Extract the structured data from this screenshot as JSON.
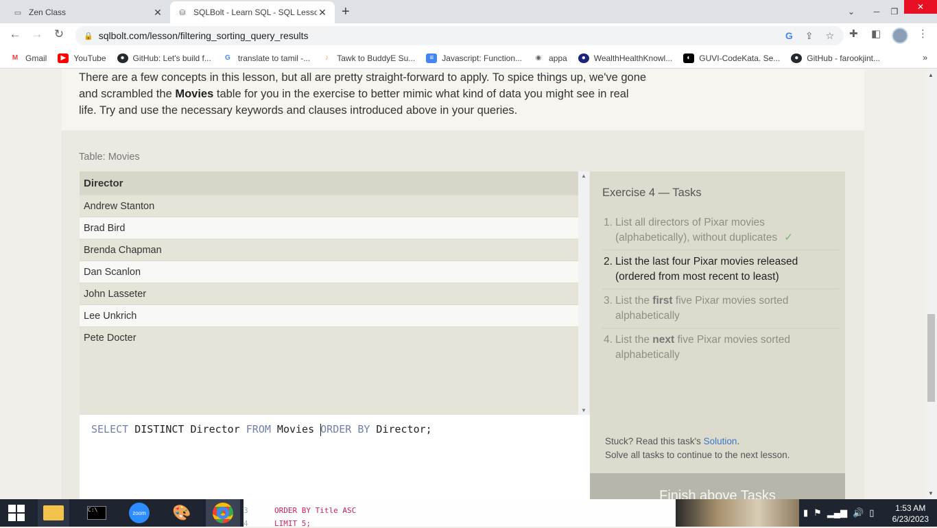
{
  "browser": {
    "tabs": [
      {
        "title": "Zen Class",
        "active": false
      },
      {
        "title": "SQLBolt - Learn SQL - SQL Lesso",
        "active": true
      }
    ],
    "url": "sqlbolt.com/lesson/filtering_sorting_query_results",
    "bookmarks": [
      {
        "label": "Gmail",
        "icon": "gmail-icon",
        "color": "#ea4335"
      },
      {
        "label": "YouTube",
        "icon": "youtube-icon",
        "color": "#ff0000"
      },
      {
        "label": "GitHub: Let's build f...",
        "icon": "github-icon",
        "color": "#24292e"
      },
      {
        "label": "translate to tamil -...",
        "icon": "google-icon",
        "color": "#4285f4"
      },
      {
        "label": "Tawk to BuddyE Su...",
        "icon": "tawk-icon",
        "color": "#f9a825"
      },
      {
        "label": "Javascript: Function...",
        "icon": "docs-icon",
        "color": "#4285f4"
      },
      {
        "label": "appa",
        "icon": "globe-icon",
        "color": "#5f6368"
      },
      {
        "label": "WealthHealthKnowl...",
        "icon": "wealth-icon",
        "color": "#1a237e"
      },
      {
        "label": "GUVI-CodeKata. Se...",
        "icon": "guvi-icon",
        "color": "#000000"
      },
      {
        "label": "GitHub - farookjint...",
        "icon": "github-icon",
        "color": "#24292e"
      }
    ]
  },
  "lesson": {
    "intro_part1": "There are a few concepts in this lesson, but all are pretty straight-forward to apply. To spice things up, we've gone and scrambled the ",
    "intro_bold": "Movies",
    "intro_part2": " table for you in the exercise to better mimic what kind of data you might see in real life. Try and use the necessary keywords and clauses introduced above in your queries.",
    "table_caption": "Table: Movies",
    "table_header": "Director",
    "table_rows": [
      "Andrew Stanton",
      "Brad Bird",
      "Brenda Chapman",
      "Dan Scanlon",
      "John Lasseter",
      "Lee Unkrich",
      "Pete Docter"
    ],
    "query": {
      "part1_kw": "SELECT",
      "part2": " DISTINCT Director ",
      "part3_kw": "FROM",
      "part4": " Movies ",
      "part5_kw": "ORDER BY",
      "part6": " Director;"
    }
  },
  "exercise": {
    "title": "Exercise 4 — Tasks",
    "tasks": [
      {
        "num": "1.",
        "text": "List all directors of Pixar movies (alphabetically), without duplicates",
        "status": "done",
        "check": "✓"
      },
      {
        "num": "2.",
        "text": "List the last four Pixar movies released (ordered from most recent to least)",
        "status": "current"
      },
      {
        "num": "3.",
        "pre": "List the ",
        "bold": "first",
        "post": " five Pixar movies sorted alphabetically",
        "status": "pending"
      },
      {
        "num": "4.",
        "pre": "List the ",
        "bold": "next",
        "post": " five Pixar movies sorted alphabetically",
        "status": "pending"
      }
    ],
    "stuck_text": "Stuck? Read this task's ",
    "solution_link": "Solution",
    "stuck_suffix": ".",
    "solve_text": "Solve all tasks to continue to the next lesson.",
    "finish_button": "Finish above Tasks"
  },
  "taskbar": {
    "preview_line1": "ORDER BY Title ASC",
    "preview_line2": "LIMIT 5;",
    "preview_num1": "3",
    "preview_num2": "4",
    "time": "1:53 AM",
    "date": "6/23/2023",
    "zoom_label": "zoom"
  }
}
